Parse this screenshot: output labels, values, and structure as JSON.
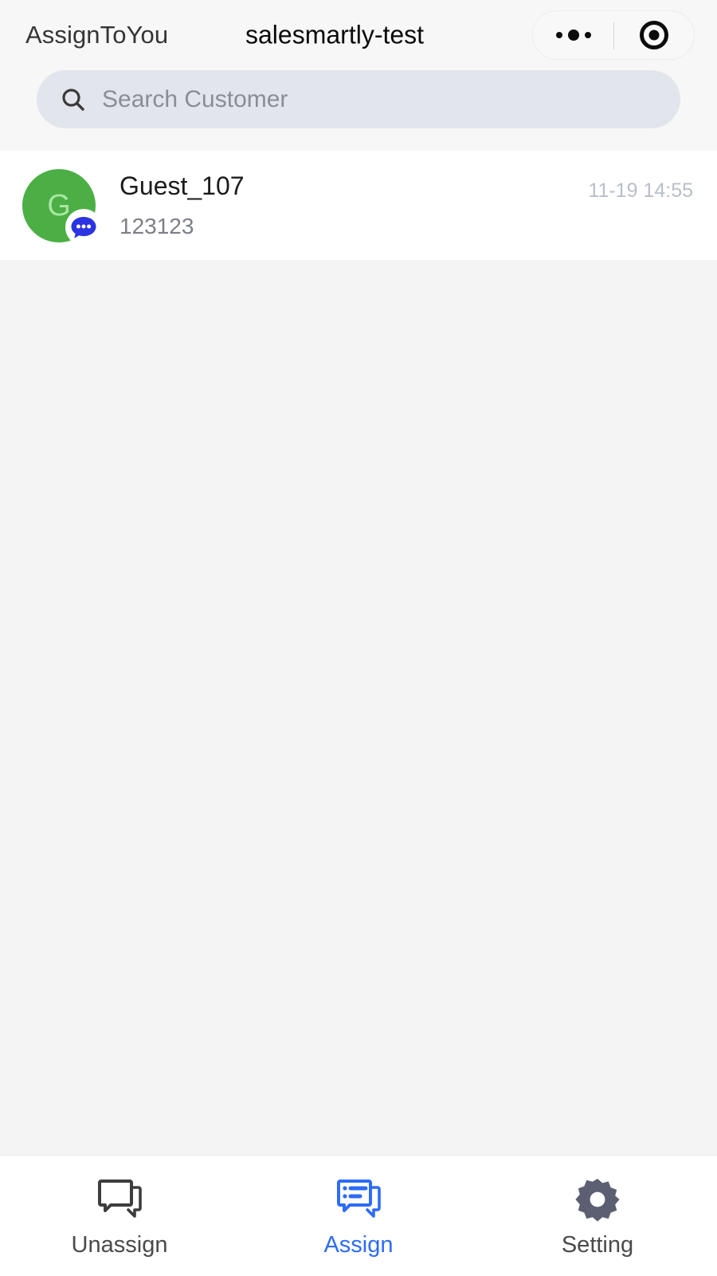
{
  "navbar": {
    "back_label": "AssignToYou",
    "title": "salesmartly-test",
    "capsule": {
      "more_icon": "more-dots-icon",
      "target_icon": "target-circle-icon"
    }
  },
  "search": {
    "icon": "search-icon",
    "placeholder": "Search Customer",
    "value": ""
  },
  "conversations": [
    {
      "avatar_letter": "G",
      "avatar_color": "#4caf45",
      "avatar_letter_color": "#a7e6a0",
      "badge_icon": "chat-bubble-badge-icon",
      "badge_color": "#2b34e0",
      "name": "Guest_107",
      "preview": "123123",
      "time": "11-19 14:55"
    }
  ],
  "tabbar": {
    "active_color": "#2d6cf6",
    "inactive_color": "#4a4a4a",
    "items": [
      {
        "label": "Unassign",
        "icon": "chat-bubbles-outline-icon",
        "active": false
      },
      {
        "label": "Assign",
        "icon": "chat-bubbles-list-icon",
        "active": true
      },
      {
        "label": "Setting",
        "icon": "gear-icon",
        "active": false
      }
    ]
  }
}
